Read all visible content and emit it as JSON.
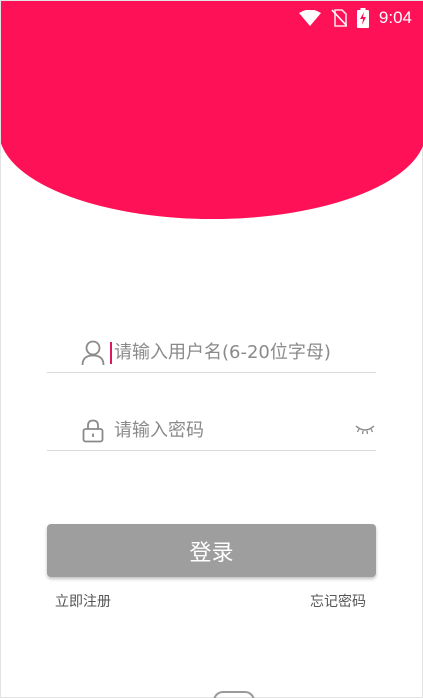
{
  "colors": {
    "brand": "#ff1158",
    "button": "#9e9e9e"
  },
  "status_bar": {
    "time": "9:04",
    "icons": [
      "wifi-icon",
      "no-sim-icon",
      "battery-charging-icon"
    ]
  },
  "login_form": {
    "username": {
      "icon": "user-icon",
      "placeholder": "请输入用户名(6-20位字母)",
      "value": ""
    },
    "password": {
      "icon": "lock-icon",
      "placeholder": "请输入密码",
      "value": "",
      "toggle_icon": "eye-closed-icon"
    },
    "submit_label": "登录",
    "register_label": "立即注册",
    "forgot_label": "忘记密码"
  }
}
